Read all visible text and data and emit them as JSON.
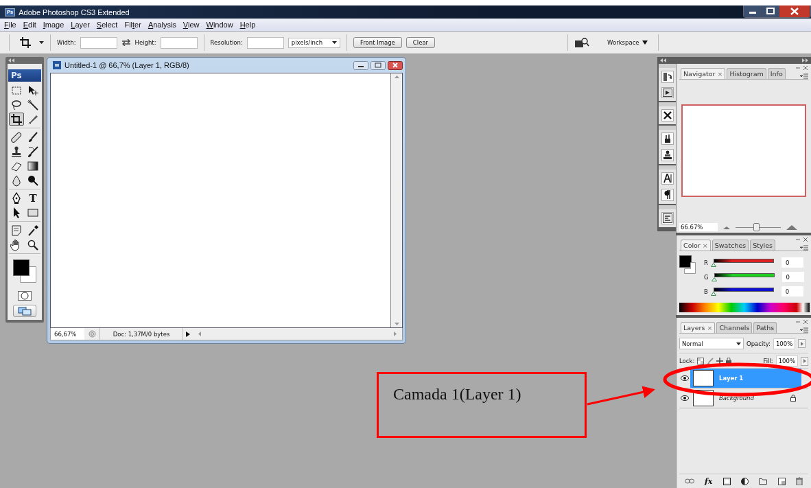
{
  "window": {
    "title": "Adobe Photoshop CS3 Extended",
    "logo": "Ps"
  },
  "menu": [
    {
      "key": "F",
      "post": "ile"
    },
    {
      "key": "E",
      "post": "dit"
    },
    {
      "key": "I",
      "post": "mage"
    },
    {
      "key": "L",
      "post": "ayer"
    },
    {
      "key": "S",
      "post": "elect"
    },
    {
      "pre": "Fil",
      "key": "t",
      "post": "er"
    },
    {
      "key": "A",
      "post": "nalysis"
    },
    {
      "key": "V",
      "post": "iew"
    },
    {
      "key": "W",
      "post": "indow"
    },
    {
      "key": "H",
      "post": "elp"
    }
  ],
  "options_bar": {
    "width_label": "Width:",
    "height_label": "Height:",
    "resolution_label": "Resolution:",
    "units": "pixels/inch",
    "buttons": [
      "Front Image",
      "Clear"
    ],
    "workspace": "Workspace"
  },
  "toolbox": {
    "logo": "Ps",
    "tool_groups": [
      {
        "tools": [
          {
            "kind": "marquee",
            "selected": false
          },
          {
            "kind": "move",
            "selected": false
          },
          {
            "kind": "lasso",
            "selected": false
          },
          {
            "kind": "wand",
            "selected": false
          },
          {
            "kind": "crop",
            "selected": true
          },
          {
            "kind": "slice",
            "selected": false
          }
        ]
      },
      {
        "tools": [
          {
            "kind": "heal",
            "selected": false
          },
          {
            "kind": "brush",
            "selected": false
          },
          {
            "kind": "stamp",
            "selected": false
          },
          {
            "kind": "history",
            "selected": false
          },
          {
            "kind": "eraser",
            "selected": false
          },
          {
            "kind": "gradient",
            "selected": false
          },
          {
            "kind": "blur",
            "selected": false
          },
          {
            "kind": "dodge",
            "selected": false
          }
        ]
      },
      {
        "tools": [
          {
            "kind": "pen",
            "selected": false
          },
          {
            "kind": "type",
            "glyph": "T",
            "selected": false
          },
          {
            "kind": "path",
            "selected": false
          },
          {
            "kind": "shape",
            "selected": false
          }
        ]
      },
      {
        "tools": [
          {
            "kind": "notes",
            "selected": false
          },
          {
            "kind": "eyedropper",
            "selected": false
          },
          {
            "kind": "hand",
            "selected": false
          },
          {
            "kind": "zoom",
            "selected": false
          }
        ]
      }
    ]
  },
  "document": {
    "title": "Untitled-1 @ 66,7% (Layer 1, RGB/8)",
    "zoom": "66,67%",
    "info": "Doc: 1,37M/0 bytes"
  },
  "navigator": {
    "tabs": [
      {
        "label": "Navigator",
        "close": "×",
        "selected": true
      },
      {
        "label": "Histogram",
        "selected": false
      },
      {
        "label": "Info",
        "selected": false
      }
    ],
    "zoom": "66.67%",
    "level": 0.45
  },
  "color_panel": {
    "tabs": [
      {
        "label": "Color",
        "close": "×",
        "selected": true
      },
      {
        "label": "Swatches",
        "selected": false
      },
      {
        "label": "Styles",
        "selected": false
      }
    ],
    "channels": [
      {
        "label": "R",
        "value": "0",
        "level": 0,
        "color": "#e02020"
      },
      {
        "label": "G",
        "value": "0",
        "level": 0,
        "color": "#20d020"
      },
      {
        "label": "B",
        "value": "0",
        "level": 0,
        "color": "#1010d0"
      }
    ]
  },
  "layers_panel": {
    "tabs": [
      {
        "label": "Layers",
        "close": "×",
        "selected": true
      },
      {
        "label": "Channels",
        "selected": false
      },
      {
        "label": "Paths",
        "selected": false
      }
    ],
    "blend_mode": "Normal",
    "opacity_label": "Opacity:",
    "opacity": "100%",
    "lock_label": "Lock:",
    "fill_label": "Fill:",
    "fill": "100%",
    "fx": "fx",
    "layers": [
      {
        "name": "Layer 1",
        "selected": true,
        "visible": true,
        "locked": false
      },
      {
        "name": "Background",
        "selected": false,
        "visible": true,
        "locked": true
      }
    ]
  },
  "annotation": {
    "text": "Camada 1(Layer 1)"
  }
}
